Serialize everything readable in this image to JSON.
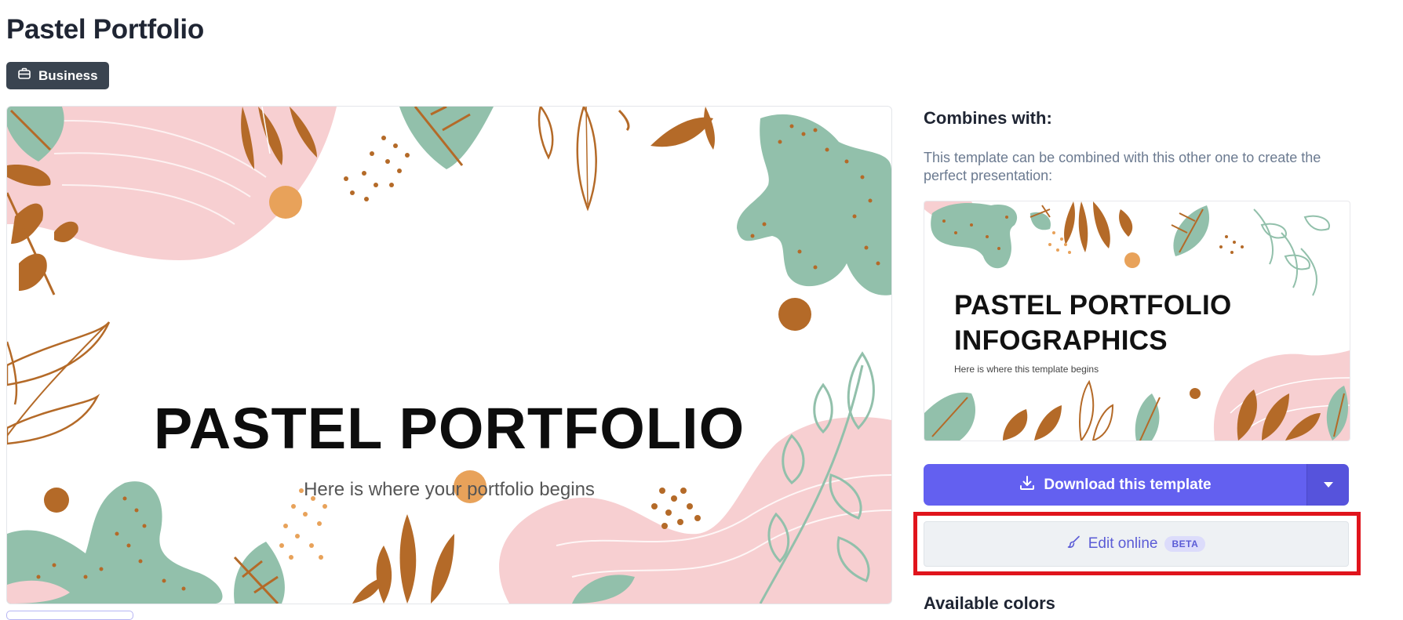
{
  "page": {
    "title": "Pastel Portfolio",
    "category": {
      "label": "Business",
      "icon": "briefcase-icon"
    }
  },
  "preview": {
    "slide_title": "PASTEL PORTFOLIO",
    "slide_subtitle": "Here is where your portfolio begins",
    "palette": {
      "pink": "#f7cfd1",
      "sage": "#92c0ab",
      "brown": "#b46a28",
      "orange": "#e8a25a"
    }
  },
  "sidebar": {
    "combines_heading": "Combines with:",
    "combines_description": "This template can be combined with this other one to create the perfect presentation:",
    "combined_template": {
      "title_line1": "PASTEL PORTFOLIO",
      "title_line2": "INFOGRAPHICS",
      "subtitle": "Here is where this template begins"
    },
    "download_label": "Download this template",
    "download_icon": "download-icon",
    "dropdown_icon": "caret-down-icon",
    "edit_online_label": "Edit online",
    "edit_online_icon": "brush-icon",
    "beta_label": "BETA",
    "available_colors_heading": "Available colors"
  },
  "colors": {
    "accent": "#6360f0",
    "highlight": "#e0141c",
    "badge": "#3a4450"
  }
}
